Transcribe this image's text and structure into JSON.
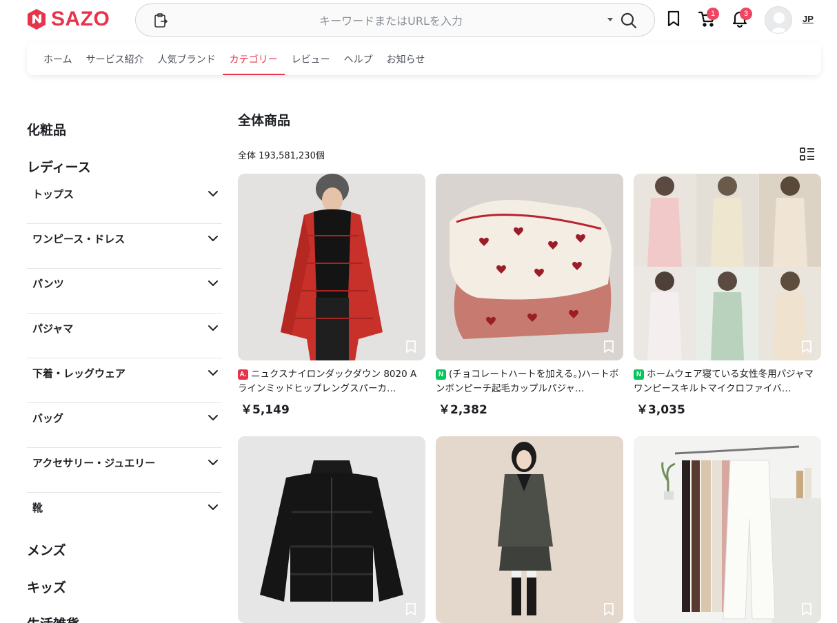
{
  "header": {
    "logo_text": "SAZO",
    "brand_color": "#e8334a",
    "search_placeholder": "キーワードまたはURLを入力",
    "cart_count": "1",
    "notification_count": "3",
    "language": "JP"
  },
  "nav": {
    "items": [
      "ホーム",
      "サービス紹介",
      "人気ブランド",
      "カテゴリー",
      "レビュー",
      "ヘルプ",
      "お知らせ"
    ],
    "active_index": 3
  },
  "sidebar": {
    "cosmetics": "化粧品",
    "ladies": "レディース",
    "ladies_items": [
      "トップス",
      "ワンピース・ドレス",
      "パンツ",
      "パジャマ",
      "下着・レッグウェア",
      "バッグ",
      "アクセサリー・ジュエリー",
      "靴"
    ],
    "mens": "メンズ",
    "kids": "キッズ",
    "daily": "生活雑貨"
  },
  "main": {
    "title": "全体商品",
    "total_label": "全体 193,581,230個"
  },
  "products": [
    {
      "source_icon": "A.",
      "source_color": "#e8334a",
      "title": "ニュクスナイロンダックダウン 8020 Aラインミッドヒップレングスパーカ…",
      "price": "￥5,149",
      "image": "red-puffer-coat"
    },
    {
      "source_icon": "N",
      "source_color": "#03c75a",
      "title": "(チョコレートハートを加える。)ハートボンボンピーチ起毛カップルパジャ…",
      "price": "￥2,382",
      "image": "heart-pajamas"
    },
    {
      "source_icon": "N",
      "source_color": "#03c75a",
      "title": "ホームウェア寝ている女性冬用パジャマワンピースキルトマイクロファイバ…",
      "price": "￥3,035",
      "image": "pajama-collage"
    },
    {
      "image": "black-puffer-jacket"
    },
    {
      "image": "grey-wool-coat"
    },
    {
      "image": "white-wide-pants"
    }
  ]
}
